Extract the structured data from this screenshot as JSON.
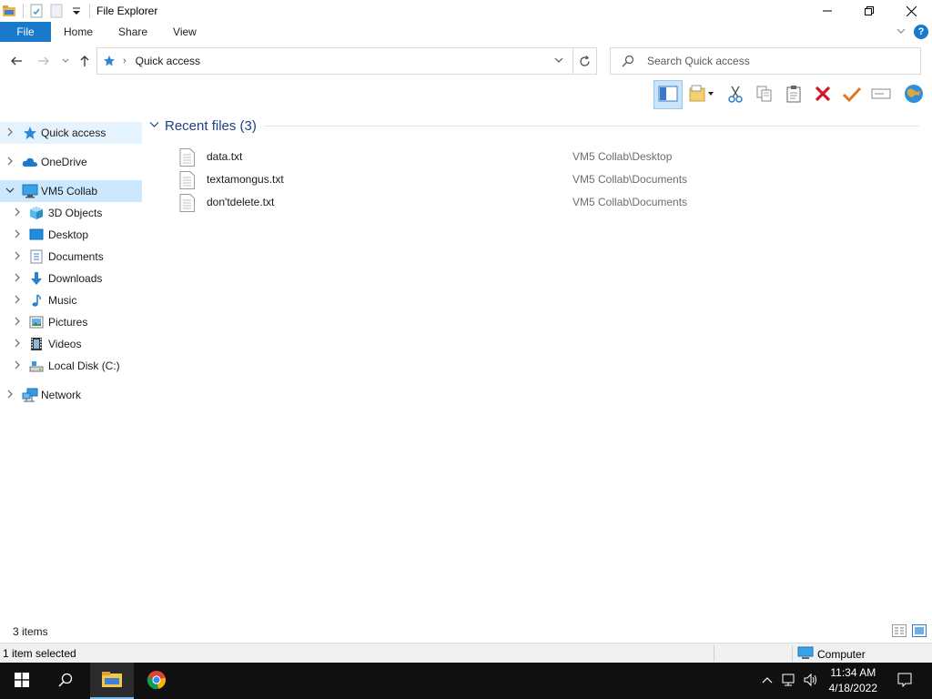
{
  "window": {
    "title": "File Explorer",
    "controls": {
      "minimize": "—",
      "restore": "❐",
      "close": "✕"
    }
  },
  "ribbon": {
    "tabs": [
      "File",
      "Home",
      "Share",
      "View"
    ],
    "help": "?"
  },
  "address": {
    "path": "Quick access",
    "search_placeholder": "Search Quick access"
  },
  "toolbar": {
    "icons": [
      "preview-pane-icon",
      "new-folder-icon",
      "cut-icon",
      "copy-icon",
      "paste-icon",
      "delete-icon",
      "checkmark-icon",
      "rename-icon",
      "globe-icon"
    ]
  },
  "navpane": {
    "items": [
      {
        "label": "Quick access",
        "icon": "star-icon",
        "level": 0,
        "state": "hover"
      },
      {
        "label": "OneDrive",
        "icon": "cloud-icon",
        "level": 0,
        "state": ""
      },
      {
        "label": "VM5 Collab",
        "icon": "computer-icon",
        "level": 0,
        "state": "selected",
        "expanded": true
      },
      {
        "label": "3D Objects",
        "icon": "cube-icon",
        "level": 1,
        "state": ""
      },
      {
        "label": "Desktop",
        "icon": "desktop-icon",
        "level": 1,
        "state": ""
      },
      {
        "label": "Documents",
        "icon": "documents-icon",
        "level": 1,
        "state": ""
      },
      {
        "label": "Downloads",
        "icon": "download-icon",
        "level": 1,
        "state": ""
      },
      {
        "label": "Music",
        "icon": "music-icon",
        "level": 1,
        "state": ""
      },
      {
        "label": "Pictures",
        "icon": "pictures-icon",
        "level": 1,
        "state": ""
      },
      {
        "label": "Videos",
        "icon": "video-icon",
        "level": 1,
        "state": ""
      },
      {
        "label": "Local Disk (C:)",
        "icon": "disk-icon",
        "level": 1,
        "state": ""
      },
      {
        "label": "Network",
        "icon": "network-icon",
        "level": 0,
        "state": ""
      }
    ]
  },
  "content": {
    "group_title": "Recent files (3)",
    "files": [
      {
        "name": "data.txt",
        "location": "VM5 Collab\\Desktop"
      },
      {
        "name": "textamongus.txt",
        "location": "VM5 Collab\\Documents"
      },
      {
        "name": "don'tdelete.txt",
        "location": "VM5 Collab\\Documents"
      }
    ]
  },
  "status": {
    "items_count": "3 items",
    "selection": "1 item selected",
    "computer": "Computer"
  },
  "taskbar": {
    "time": "11:34 AM",
    "date": "4/18/2022"
  },
  "colors": {
    "accent": "#1979ca",
    "selected": "#cce8ff",
    "group_title": "#1e3f8a",
    "taskbar": "#101010"
  }
}
